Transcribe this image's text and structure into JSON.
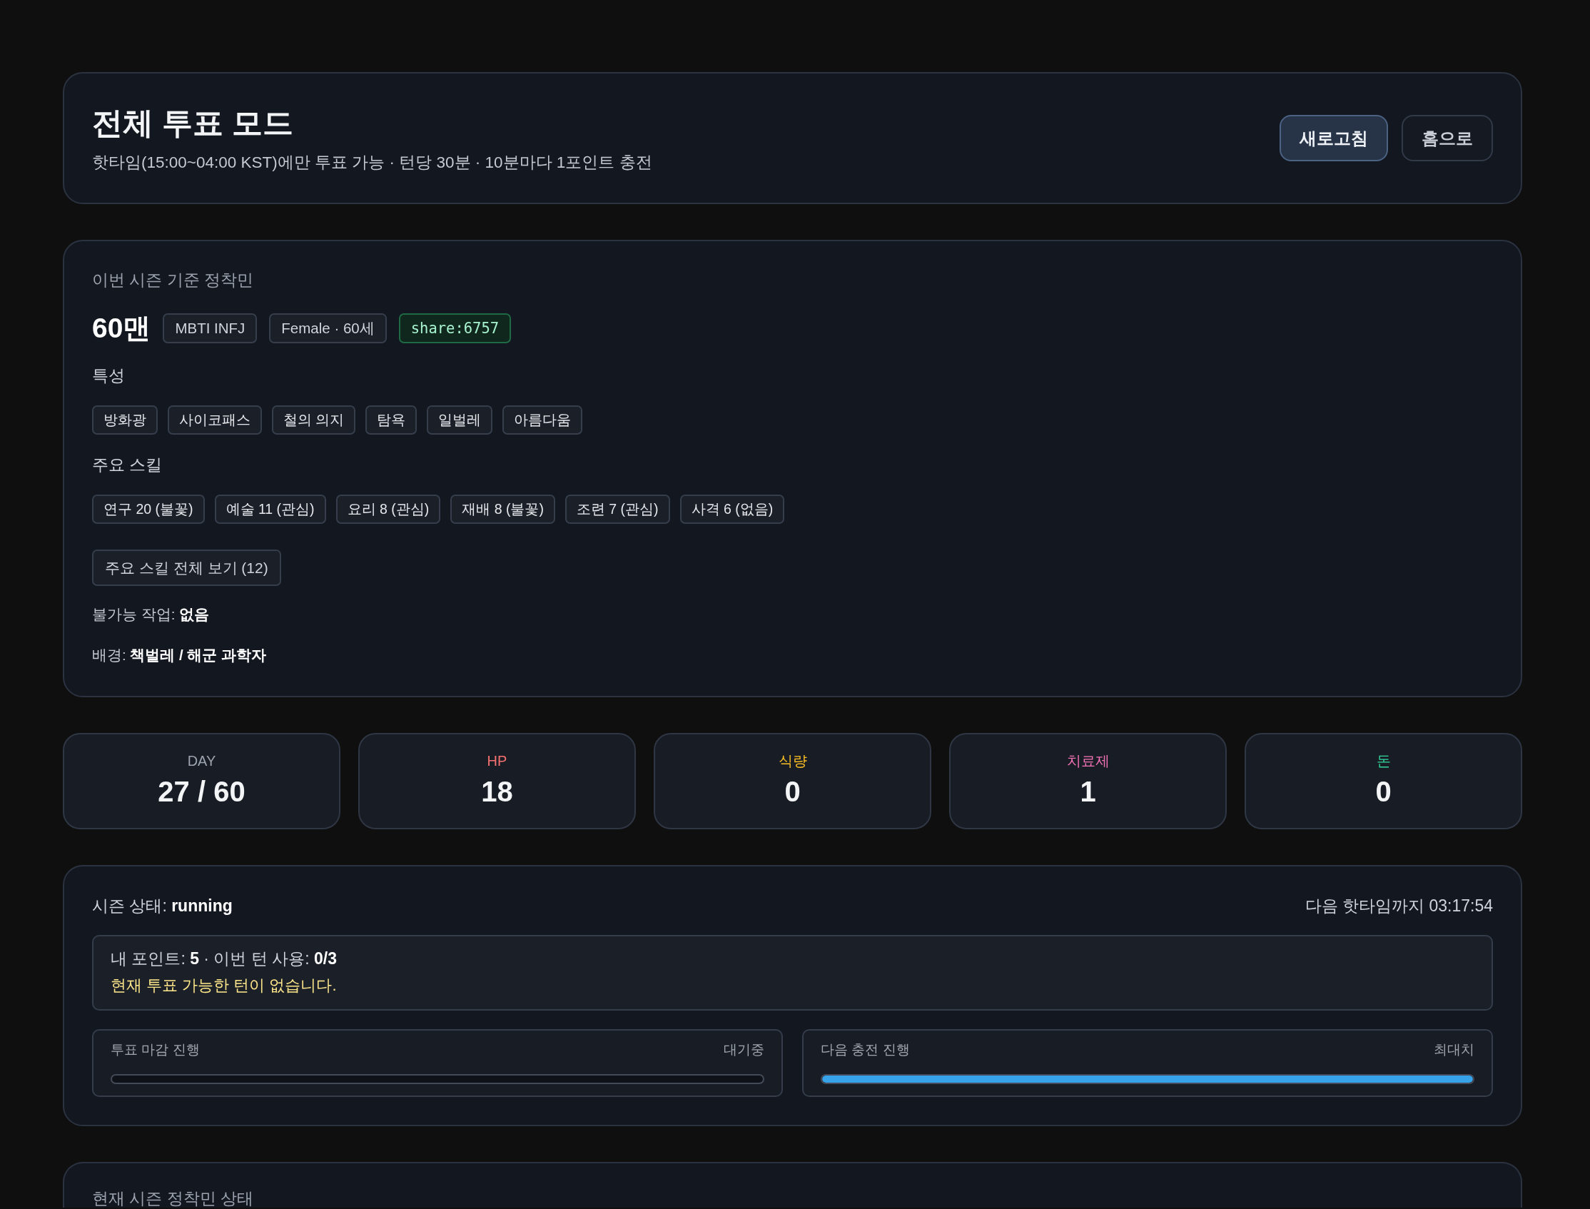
{
  "header": {
    "title": "전체 투표 모드",
    "subtitle": "핫타임(15:00~04:00 KST)에만 투표 가능 · 턴당 30분 · 10분마다 1포인트 충전",
    "buttons": [
      {
        "label": "새로고침",
        "kind": "primary"
      },
      {
        "label": "홈으로",
        "kind": "secondary"
      }
    ]
  },
  "settler": {
    "caption": "이번 시즌 기준 정착민",
    "name": "60맨",
    "tags": [
      {
        "label": "MBTI INFJ",
        "kind": "plain"
      },
      {
        "label": "Female · 60세",
        "kind": "plain"
      },
      {
        "label": "share:6757",
        "kind": "code"
      }
    ],
    "traits_heading": "특성",
    "traits": [
      "방화광",
      "사이코패스",
      "철의 의지",
      "탐욕",
      "일벌레",
      "아름다움"
    ],
    "skills_heading": "주요 스킬",
    "skills": [
      "연구 20 (불꽃)",
      "예술 11 (관심)",
      "요리 8 (관심)",
      "재배 8 (불꽃)",
      "조련 7 (관심)",
      "사격 6 (없음)"
    ],
    "all_skills_button": "주요 스킬 전체 보기 (12)",
    "facts": [
      "불가능 작업: **없음**",
      "배경: **책벌레 / 해군 과학자**"
    ]
  },
  "stats": [
    {
      "label": "DAY",
      "value": "27 / 60",
      "color": "#9ca3af"
    },
    {
      "label": "HP",
      "value": "18",
      "color": "#f87171"
    },
    {
      "label": "식량",
      "value": "0",
      "color": "#fbbf24"
    },
    {
      "label": "치료제",
      "value": "1",
      "color": "#f472b6"
    },
    {
      "label": "돈",
      "value": "0",
      "color": "#34d399"
    }
  ],
  "season": {
    "status": "시즌 상태: **running**",
    "countdown": "다음 핫타임까지 03:17:54",
    "points": "내 포인트: **5** · 이번 턴 사용: **0/3**",
    "notice": "현재 투표 가능한 턴이 없습니다.",
    "progress": [
      {
        "label": "투표 마감 진행",
        "state": "대기중"
      },
      {
        "label": "다음 충전 진행",
        "state": "최대치",
        "level": 1
      }
    ]
  },
  "next_section": {
    "title": "현재 시즌 정착민 상태"
  }
}
